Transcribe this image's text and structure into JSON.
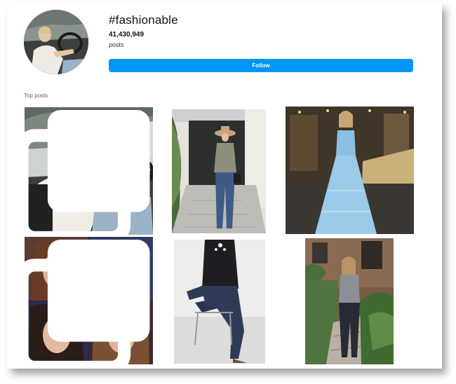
{
  "header": {
    "hashtag": "#fashionable",
    "post_count": "41,430,949",
    "post_count_label": "posts",
    "follow_label": "Follow"
  },
  "sections": {
    "top_posts_title": "Top posts"
  },
  "colors": {
    "follow_button": "#0095f6",
    "page_background": "#ffffff"
  },
  "posts": [
    {
      "subject": "woman driving convertible car",
      "multi": true
    },
    {
      "subject": "woman in hat and jeans on sidewalk",
      "multi": false
    },
    {
      "subject": "woman in blue sequin gown by vintage car",
      "multi": false
    },
    {
      "subject": "collage of four portraits",
      "multi": true
    },
    {
      "subject": "person seated on chair in denim",
      "multi": false
    },
    {
      "subject": "woman on brownstone stoop with plants",
      "multi": false
    }
  ]
}
